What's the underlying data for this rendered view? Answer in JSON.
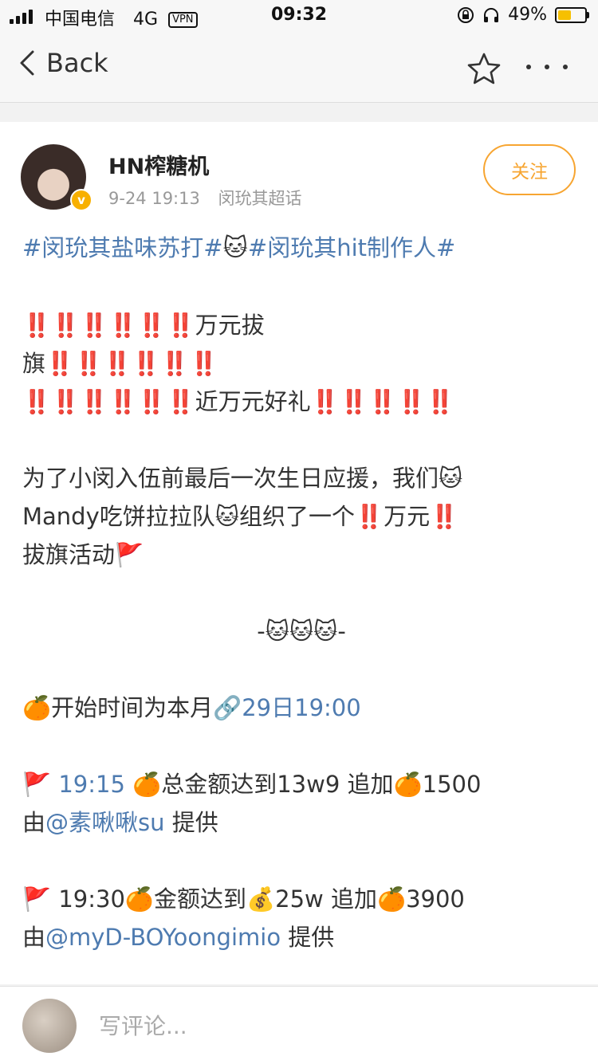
{
  "status_bar": {
    "carrier": "中国电信",
    "network": "4G",
    "vpn": "VPN",
    "time": "09:32",
    "battery": "49%",
    "battery_level": 0.49
  },
  "nav": {
    "back_label": "Back",
    "favorite_icon": "star-icon",
    "more_icon": "more-icon"
  },
  "post": {
    "username": "HN榨糖机",
    "date": "9-24 19:13",
    "source": "闵玧其超话",
    "follow_label": "关注",
    "lines": {
      "l1_tag1": "#闵玧其盐味苏打#",
      "l1_cat": "🐱",
      "l1_tag2": "#闵玧其hit制作人#",
      "l2": "‼️‼️‼️‼️‼️‼️万元拔",
      "l3": "旗‼️‼️‼️‼️‼️‼️",
      "l4": "‼️‼️‼️‼️‼️‼️近万元好礼‼️‼️‼️‼️‼️",
      "l5": "为了小闵入伍前最后一次生日应援，我们🐱",
      "l6": "Mandy吃饼拉拉队🐱组织了一个‼️万元‼️",
      "l7": "拔旗活动🚩",
      "l8": "-🐱🐱🐱-",
      "l9_text": "🍊开始时间为本月",
      "l9_link": "🔗29日19:00",
      "l10_flag": "🚩",
      "l10_time": "19:15",
      "l10_text": "🍊总金额达到13w9 追加🍊1500",
      "l11_prefix": "由",
      "l11_mention": "@素啾啾su",
      "l11_suffix": "提供",
      "l12": "🚩 19:30🍊金额达到💰25w 追加🍊3900",
      "l13_prefix": "由",
      "l13_mention": "@myD-BOYoongimio",
      "l13_suffix": "提供"
    }
  },
  "comment_bar": {
    "placeholder": "写评论..."
  },
  "colors": {
    "link": "#4e7bb0",
    "follow": "#f7a531",
    "verified": "#f8b000",
    "background": "#f2f2f2"
  }
}
